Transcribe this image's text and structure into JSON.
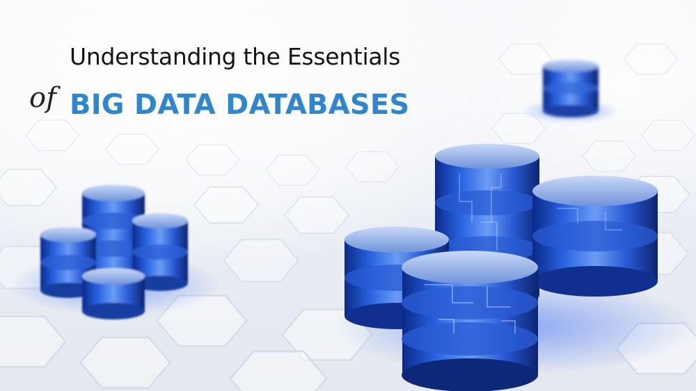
{
  "headline": {
    "line1": "Understanding the Essentials",
    "connector": "of",
    "line2": "BIG DATA DATABASES"
  },
  "colors": {
    "title_dark": "#141414",
    "title_accent": "#2f86cc",
    "cylinder_blue": "#1e4fc8",
    "background": "#f4f6fa"
  },
  "scene": {
    "elements": [
      "hexagon-floor",
      "database-cluster-front",
      "database-cluster-left",
      "database-stack-far"
    ]
  }
}
